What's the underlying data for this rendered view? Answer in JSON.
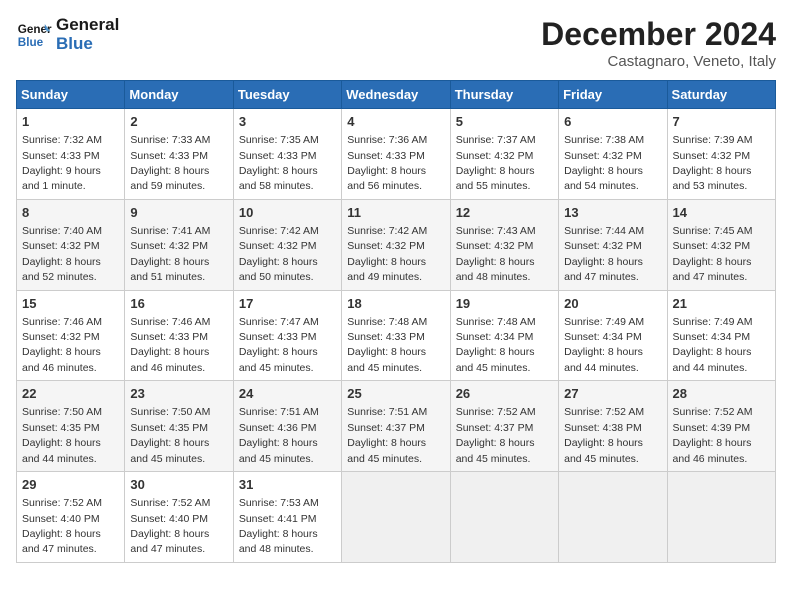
{
  "header": {
    "logo_line1": "General",
    "logo_line2": "Blue",
    "month": "December 2024",
    "location": "Castagnaro, Veneto, Italy"
  },
  "days_of_week": [
    "Sunday",
    "Monday",
    "Tuesday",
    "Wednesday",
    "Thursday",
    "Friday",
    "Saturday"
  ],
  "weeks": [
    [
      {
        "day": "1",
        "sunrise": "Sunrise: 7:32 AM",
        "sunset": "Sunset: 4:33 PM",
        "daylight": "Daylight: 9 hours and 1 minute."
      },
      {
        "day": "2",
        "sunrise": "Sunrise: 7:33 AM",
        "sunset": "Sunset: 4:33 PM",
        "daylight": "Daylight: 8 hours and 59 minutes."
      },
      {
        "day": "3",
        "sunrise": "Sunrise: 7:35 AM",
        "sunset": "Sunset: 4:33 PM",
        "daylight": "Daylight: 8 hours and 58 minutes."
      },
      {
        "day": "4",
        "sunrise": "Sunrise: 7:36 AM",
        "sunset": "Sunset: 4:33 PM",
        "daylight": "Daylight: 8 hours and 56 minutes."
      },
      {
        "day": "5",
        "sunrise": "Sunrise: 7:37 AM",
        "sunset": "Sunset: 4:32 PM",
        "daylight": "Daylight: 8 hours and 55 minutes."
      },
      {
        "day": "6",
        "sunrise": "Sunrise: 7:38 AM",
        "sunset": "Sunset: 4:32 PM",
        "daylight": "Daylight: 8 hours and 54 minutes."
      },
      {
        "day": "7",
        "sunrise": "Sunrise: 7:39 AM",
        "sunset": "Sunset: 4:32 PM",
        "daylight": "Daylight: 8 hours and 53 minutes."
      }
    ],
    [
      {
        "day": "8",
        "sunrise": "Sunrise: 7:40 AM",
        "sunset": "Sunset: 4:32 PM",
        "daylight": "Daylight: 8 hours and 52 minutes."
      },
      {
        "day": "9",
        "sunrise": "Sunrise: 7:41 AM",
        "sunset": "Sunset: 4:32 PM",
        "daylight": "Daylight: 8 hours and 51 minutes."
      },
      {
        "day": "10",
        "sunrise": "Sunrise: 7:42 AM",
        "sunset": "Sunset: 4:32 PM",
        "daylight": "Daylight: 8 hours and 50 minutes."
      },
      {
        "day": "11",
        "sunrise": "Sunrise: 7:42 AM",
        "sunset": "Sunset: 4:32 PM",
        "daylight": "Daylight: 8 hours and 49 minutes."
      },
      {
        "day": "12",
        "sunrise": "Sunrise: 7:43 AM",
        "sunset": "Sunset: 4:32 PM",
        "daylight": "Daylight: 8 hours and 48 minutes."
      },
      {
        "day": "13",
        "sunrise": "Sunrise: 7:44 AM",
        "sunset": "Sunset: 4:32 PM",
        "daylight": "Daylight: 8 hours and 47 minutes."
      },
      {
        "day": "14",
        "sunrise": "Sunrise: 7:45 AM",
        "sunset": "Sunset: 4:32 PM",
        "daylight": "Daylight: 8 hours and 47 minutes."
      }
    ],
    [
      {
        "day": "15",
        "sunrise": "Sunrise: 7:46 AM",
        "sunset": "Sunset: 4:32 PM",
        "daylight": "Daylight: 8 hours and 46 minutes."
      },
      {
        "day": "16",
        "sunrise": "Sunrise: 7:46 AM",
        "sunset": "Sunset: 4:33 PM",
        "daylight": "Daylight: 8 hours and 46 minutes."
      },
      {
        "day": "17",
        "sunrise": "Sunrise: 7:47 AM",
        "sunset": "Sunset: 4:33 PM",
        "daylight": "Daylight: 8 hours and 45 minutes."
      },
      {
        "day": "18",
        "sunrise": "Sunrise: 7:48 AM",
        "sunset": "Sunset: 4:33 PM",
        "daylight": "Daylight: 8 hours and 45 minutes."
      },
      {
        "day": "19",
        "sunrise": "Sunrise: 7:48 AM",
        "sunset": "Sunset: 4:34 PM",
        "daylight": "Daylight: 8 hours and 45 minutes."
      },
      {
        "day": "20",
        "sunrise": "Sunrise: 7:49 AM",
        "sunset": "Sunset: 4:34 PM",
        "daylight": "Daylight: 8 hours and 44 minutes."
      },
      {
        "day": "21",
        "sunrise": "Sunrise: 7:49 AM",
        "sunset": "Sunset: 4:34 PM",
        "daylight": "Daylight: 8 hours and 44 minutes."
      }
    ],
    [
      {
        "day": "22",
        "sunrise": "Sunrise: 7:50 AM",
        "sunset": "Sunset: 4:35 PM",
        "daylight": "Daylight: 8 hours and 44 minutes."
      },
      {
        "day": "23",
        "sunrise": "Sunrise: 7:50 AM",
        "sunset": "Sunset: 4:35 PM",
        "daylight": "Daylight: 8 hours and 45 minutes."
      },
      {
        "day": "24",
        "sunrise": "Sunrise: 7:51 AM",
        "sunset": "Sunset: 4:36 PM",
        "daylight": "Daylight: 8 hours and 45 minutes."
      },
      {
        "day": "25",
        "sunrise": "Sunrise: 7:51 AM",
        "sunset": "Sunset: 4:37 PM",
        "daylight": "Daylight: 8 hours and 45 minutes."
      },
      {
        "day": "26",
        "sunrise": "Sunrise: 7:52 AM",
        "sunset": "Sunset: 4:37 PM",
        "daylight": "Daylight: 8 hours and 45 minutes."
      },
      {
        "day": "27",
        "sunrise": "Sunrise: 7:52 AM",
        "sunset": "Sunset: 4:38 PM",
        "daylight": "Daylight: 8 hours and 45 minutes."
      },
      {
        "day": "28",
        "sunrise": "Sunrise: 7:52 AM",
        "sunset": "Sunset: 4:39 PM",
        "daylight": "Daylight: 8 hours and 46 minutes."
      }
    ],
    [
      {
        "day": "29",
        "sunrise": "Sunrise: 7:52 AM",
        "sunset": "Sunset: 4:40 PM",
        "daylight": "Daylight: 8 hours and 47 minutes."
      },
      {
        "day": "30",
        "sunrise": "Sunrise: 7:52 AM",
        "sunset": "Sunset: 4:40 PM",
        "daylight": "Daylight: 8 hours and 47 minutes."
      },
      {
        "day": "31",
        "sunrise": "Sunrise: 7:53 AM",
        "sunset": "Sunset: 4:41 PM",
        "daylight": "Daylight: 8 hours and 48 minutes."
      },
      null,
      null,
      null,
      null
    ]
  ]
}
